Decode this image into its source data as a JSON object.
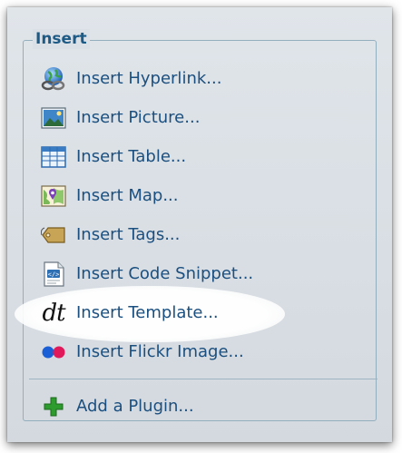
{
  "group": {
    "title": "Insert"
  },
  "items": [
    {
      "label": "Insert Hyperlink...",
      "icon": "hyperlink-globe-icon"
    },
    {
      "label": "Insert Picture...",
      "icon": "picture-icon"
    },
    {
      "label": "Insert Table...",
      "icon": "table-icon"
    },
    {
      "label": "Insert Map...",
      "icon": "map-icon"
    },
    {
      "label": "Insert Tags...",
      "icon": "tag-icon"
    },
    {
      "label": "Insert Code Snippet...",
      "icon": "code-snippet-icon"
    },
    {
      "label": "Insert Template...",
      "icon": "template-icon",
      "glyph": "dt",
      "highlighted": true
    },
    {
      "label": "Insert Flickr Image...",
      "icon": "flickr-icon"
    }
  ],
  "footer": {
    "label": "Add a Plugin...",
    "icon": "add-plugin-icon"
  },
  "colors": {
    "link": "#1b4f7f",
    "title": "#1d5b86",
    "panel": "#dbe0e6",
    "border": "#93aebd",
    "flickr_blue": "#1b5fd6",
    "flickr_pink": "#e0195a",
    "plus_green": "#2e9b2e"
  }
}
